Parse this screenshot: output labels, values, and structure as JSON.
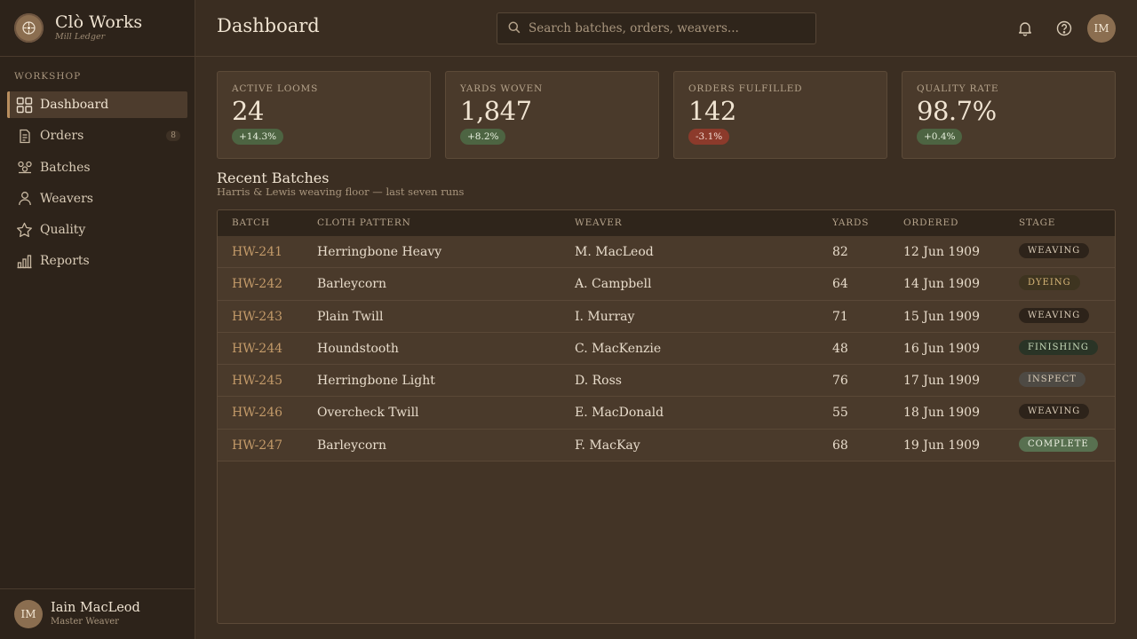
{
  "brand": {
    "name": "Clò Works",
    "sub": "Mill Ledger"
  },
  "sidebar": {
    "section": "WORKSHOP",
    "items": [
      {
        "label": "Dashboard",
        "icon": "dashboard-grid-icon",
        "active": true
      },
      {
        "label": "Orders",
        "icon": "document-icon",
        "badge": "8"
      },
      {
        "label": "Batches",
        "icon": "spools-icon"
      },
      {
        "label": "Weavers",
        "icon": "person-icon"
      },
      {
        "label": "Quality",
        "icon": "star-icon"
      },
      {
        "label": "Reports",
        "icon": "bar-chart-icon"
      }
    ]
  },
  "user": {
    "initials": "IM",
    "name": "Iain MacLeod",
    "role": "Master Weaver"
  },
  "header": {
    "title": "Dashboard",
    "search_placeholder": "Search batches, orders, weavers...",
    "avatar_initials": "IM"
  },
  "stats": [
    {
      "label": "ACTIVE LOOMS",
      "value": "24",
      "delta": "+14.3%",
      "direction": "up"
    },
    {
      "label": "YARDS WOVEN",
      "value": "1,847",
      "delta": "+8.2%",
      "direction": "up"
    },
    {
      "label": "ORDERS FULFILLED",
      "value": "142",
      "delta": "-3.1%",
      "direction": "down"
    },
    {
      "label": "QUALITY RATE",
      "value": "98.7%",
      "delta": "+0.4%",
      "direction": "up"
    }
  ],
  "recent": {
    "title": "Recent Batches",
    "subtitle": "Harris & Lewis weaving floor — last seven runs",
    "columns": [
      "BATCH",
      "CLOTH PATTERN",
      "WEAVER",
      "YARDS",
      "ORDERED",
      "STAGE"
    ],
    "rows": [
      {
        "batch": "HW-241",
        "pattern": "Herringbone Heavy",
        "weaver": "M. MacLeod",
        "yards": "82",
        "ordered": "12 Jun 1909",
        "stage": "WEAVING",
        "stage_key": "weaving"
      },
      {
        "batch": "HW-242",
        "pattern": "Barleycorn",
        "weaver": "A. Campbell",
        "yards": "64",
        "ordered": "14 Jun 1909",
        "stage": "DYEING",
        "stage_key": "dyeing"
      },
      {
        "batch": "HW-243",
        "pattern": "Plain Twill",
        "weaver": "I. Murray",
        "yards": "71",
        "ordered": "15 Jun 1909",
        "stage": "WEAVING",
        "stage_key": "weaving"
      },
      {
        "batch": "HW-244",
        "pattern": "Houndstooth",
        "weaver": "C. MacKenzie",
        "yards": "48",
        "ordered": "16 Jun 1909",
        "stage": "FINISHING",
        "stage_key": "finishing"
      },
      {
        "batch": "HW-245",
        "pattern": "Herringbone Light",
        "weaver": "D. Ross",
        "yards": "76",
        "ordered": "17 Jun 1909",
        "stage": "INSPECT",
        "stage_key": "inspect"
      },
      {
        "batch": "HW-246",
        "pattern": "Overcheck Twill",
        "weaver": "E. MacDonald",
        "yards": "55",
        "ordered": "18 Jun 1909",
        "stage": "WEAVING",
        "stage_key": "weaving"
      },
      {
        "batch": "HW-247",
        "pattern": "Barleycorn",
        "weaver": "F. MacKay",
        "yards": "68",
        "ordered": "19 Jun 1909",
        "stage": "COMPLETE",
        "stage_key": "complete"
      }
    ]
  },
  "colors": {
    "accent": "#b88e5e",
    "background": "#3b2e22",
    "sidebar": "#2d231a"
  }
}
